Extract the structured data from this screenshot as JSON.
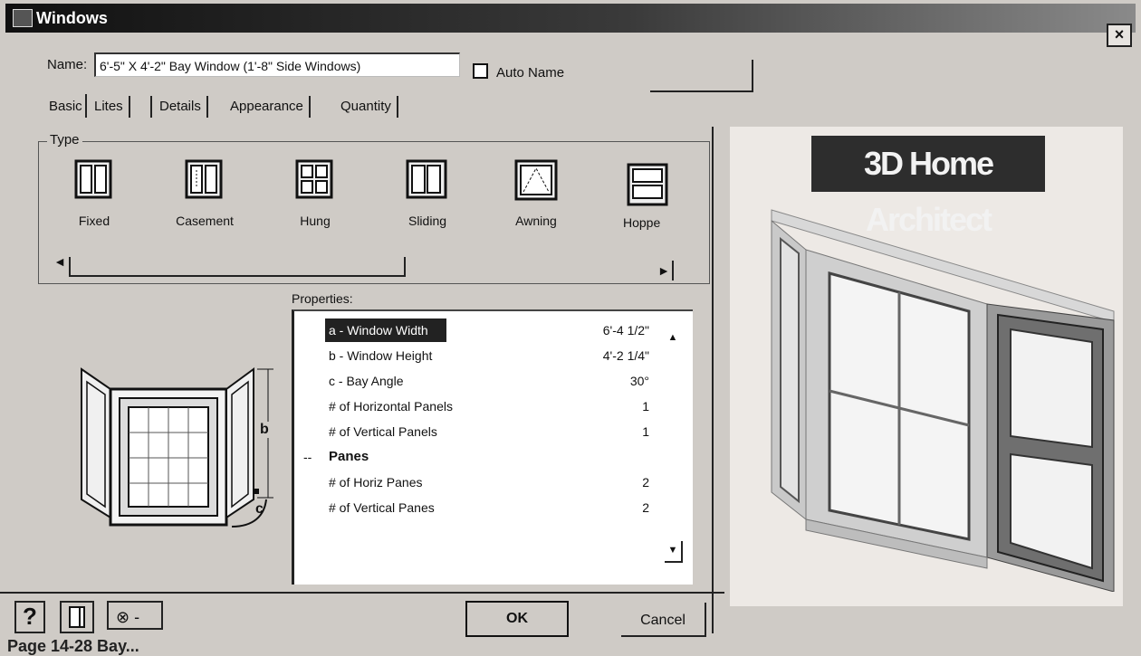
{
  "window": {
    "title": "Windows",
    "close_label": "×"
  },
  "name_row": {
    "label": "Name:",
    "value": "6'-5\" X 4'-2\" Bay Window (1'-8\" Side Windows)",
    "auto_name_label": "Auto Name",
    "auto_name_checked": false
  },
  "tabs": [
    {
      "label": "Basic",
      "active": true
    },
    {
      "label": "Lites"
    },
    {
      "label": "Details"
    },
    {
      "label": "Appearance"
    },
    {
      "label": "Quantity"
    }
  ],
  "type_group": {
    "label": "Type",
    "items": [
      {
        "label": "Fixed",
        "icon": "fixed-window-icon"
      },
      {
        "label": "Casement",
        "icon": "casement-window-icon"
      },
      {
        "label": "Hung",
        "icon": "hung-window-icon"
      },
      {
        "label": "Sliding",
        "icon": "sliding-window-icon"
      },
      {
        "label": "Awning",
        "icon": "awning-window-icon"
      },
      {
        "label": "Hoppe",
        "icon": "hopper-window-icon"
      }
    ],
    "scroll_left": "◄",
    "scroll_right": "►"
  },
  "diagram": {
    "label_b": "b",
    "label_c": "c"
  },
  "properties": {
    "label": "Properties:",
    "rows": [
      {
        "name": "a - Window Width",
        "value": "6'-4 1/2\"",
        "selected": true
      },
      {
        "name": "b - Window Height",
        "value": "4'-2 1/4\""
      },
      {
        "name": "c - Bay Angle",
        "value": "30°"
      },
      {
        "name": "# of Horizontal Panels",
        "value": "1"
      },
      {
        "name": "# of Vertical Panels",
        "value": "1"
      },
      {
        "name": "Panes",
        "value": "",
        "group": true,
        "prefix": "--"
      },
      {
        "name": "# of Horiz Panes",
        "value": "2"
      },
      {
        "name": "# of Vertical Panes",
        "value": "2"
      }
    ]
  },
  "preview": {
    "brand": "3D Home Architect"
  },
  "buttons": {
    "help": "?",
    "ok": "OK",
    "cancel": "Cancel",
    "globe_dropdown": "-"
  },
  "caption": "Page 14-28  Bay..."
}
